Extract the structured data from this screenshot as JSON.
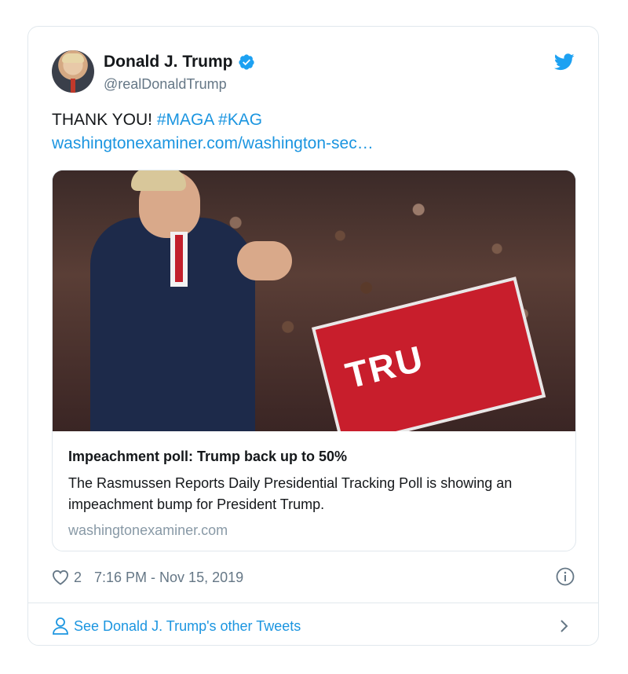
{
  "author": {
    "name": "Donald J. Trump",
    "handle": "@realDonaldTrump"
  },
  "tweet": {
    "text": "THANK YOU!",
    "hashtags": [
      "#MAGA",
      "#KAG"
    ],
    "link_text": "washingtonexaminer.com/washington-sec…"
  },
  "link_card": {
    "image_sign_text": "TRU",
    "title": "Impeachment poll: Trump back up to 50%",
    "description": "The Rasmussen Reports Daily Presidential Tracking Poll is showing an impeachment bump for President Trump.",
    "domain": "washingtonexaminer.com"
  },
  "meta": {
    "likes": "2",
    "timestamp": "7:16 PM - Nov 15, 2019"
  },
  "footer": {
    "label": "See Donald J. Trump's other Tweets"
  },
  "icons": [
    "verified-badge-icon",
    "twitter-bird-icon",
    "heart-icon",
    "info-icon",
    "person-icon",
    "chevron-right-icon"
  ],
  "colors": {
    "accent": "#1b95e0",
    "text": "#14171a",
    "muted": "#657786",
    "border": "#e1e8ed"
  }
}
